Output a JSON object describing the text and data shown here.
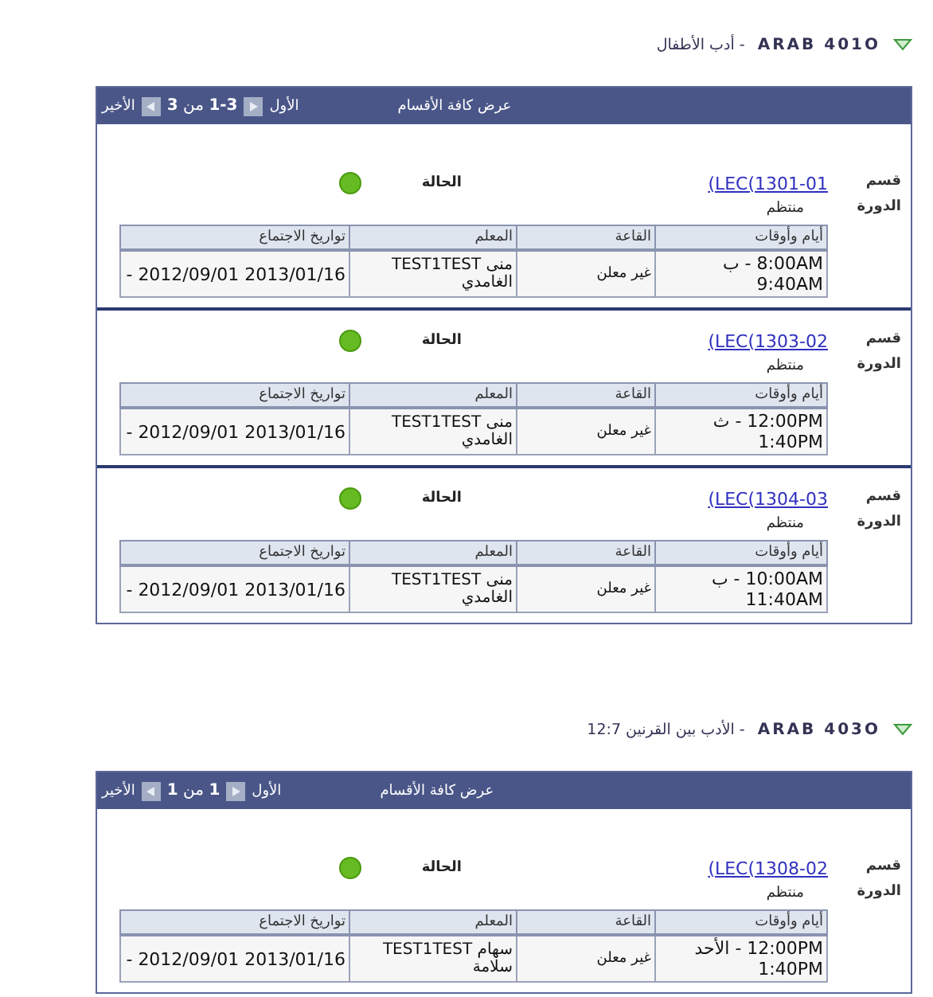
{
  "courses": [
    {
      "code": "ARAB  401O",
      "name": "- أدب الأطفال",
      "expanded": true,
      "nav": {
        "show_all": "عرض كافة الأقسام",
        "first": "الأول",
        "counter": "**1-3** من **3**",
        "last": "الأخير"
      },
      "sections": [
        {
          "label": "قسم الدورة",
          "link": "(LEC(1301-01",
          "status_label": "الحالة",
          "color": "#66bb22",
          "type": "منتظم",
          "columns": [
            "أيام وأوقات",
            "القاعة",
            "المعلم",
            "تواريخ الاجتماع"
          ],
          "cells": [
            "ب - 8:00AM 9:40AM",
            "غير معلن",
            "منى TEST1TEST الغامدي",
            "- 2012/09/01 2013/01/16"
          ]
        },
        {
          "label": "قسم الدورة",
          "link": "(LEC(1303-02",
          "status_label": "الحالة",
          "color": "#66bb22",
          "type": "منتظم",
          "columns": [
            "أيام وأوقات",
            "القاعة",
            "المعلم",
            "تواريخ الاجتماع"
          ],
          "cells": [
            "ث - 12:00PM 1:40PM",
            "غير معلن",
            "منى TEST1TEST الغامدي",
            "- 2012/09/01 2013/01/16"
          ]
        },
        {
          "label": "قسم الدورة",
          "link": "(LEC(1304-03",
          "status_label": "الحالة",
          "color": "#66bb22",
          "type": "منتظم",
          "columns": [
            "أيام وأوقات",
            "القاعة",
            "المعلم",
            "تواريخ الاجتماع"
          ],
          "cells": [
            "ب - 10:00AM 11:40AM",
            "غير معلن",
            "منى TEST1TEST الغامدي",
            "- 2012/09/01 2013/01/16"
          ]
        }
      ]
    },
    {
      "code": "ARAB  403O",
      "name": "- الأدب بين القرنين 12:7",
      "expanded": true,
      "nav": {
        "show_all": "عرض كافة الأقسام",
        "first": "الأول",
        "counter": "**1** من **1**",
        "last": "الأخير"
      },
      "sections": [
        {
          "label": "قسم الدورة",
          "link": "(LEC(1308-02",
          "status_label": "الحالة",
          "color": "#66bb22",
          "type": "منتظم",
          "columns": [
            "أيام وأوقات",
            "القاعة",
            "المعلم",
            "تواريخ الاجتماع"
          ],
          "cells": [
            "الأحد - 12:00PM 1:40PM",
            "غير معلن",
            "سهام TEST1TEST سلامة",
            "- 2012/09/01 2013/01/16"
          ]
        }
      ]
    }
  ]
}
